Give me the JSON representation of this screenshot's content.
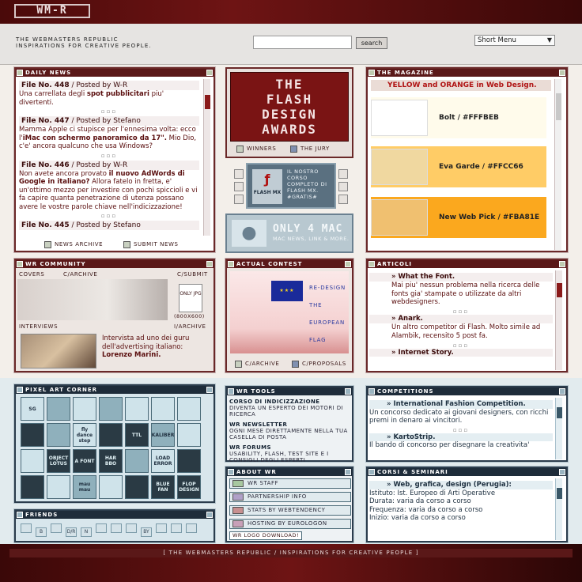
{
  "header": {
    "logo": "WM-R",
    "tagline_1": "THE WEBMASTERS REPUBLIC",
    "tagline_2": "INSPIRATIONS FOR CREATIVE PEOPLE.",
    "search_placeholder": "",
    "search_button": "search",
    "short_menu": "Short Menu"
  },
  "daily_news": {
    "title": "DAILY NEWS",
    "items": [
      {
        "num": "File No. 448",
        "by": " / Posted by W-R",
        "body_pre": "Una carrellata degli ",
        "body_bold": "spot pubblicitari",
        "body_post": " piu' divertenti."
      },
      {
        "num": "File No. 447",
        "by": " / Posted by Stefano",
        "body_pre": "Mamma Apple ci stupisce per l'ennesima volta: ecco l'",
        "body_bold": "iMac con schermo panoramico da 17\".",
        "body_post": " Mio Dio, c'e' ancora qualcuno che usa Windows?"
      },
      {
        "num": "File No. 446",
        "by": " / Posted by W-R",
        "body_pre": "Non avete ancora provato ",
        "body_bold": "il nuovo AdWords di Google in italiano?",
        "body_post": " Allora fatelo in fretta, e' un'ottimo mezzo per investire con pochi spiccioli e vi fa capire quanta penetrazione di utenza possano avere le vostre parole chiave nell'indicizzazione!"
      },
      {
        "num": "File No. 445",
        "by": " / Posted by Stefano"
      }
    ],
    "news_archive": "NEWS ARCHIVE",
    "submit_news": "SUBMIT NEWS"
  },
  "flash_awards": {
    "line1": "THE",
    "line2": "FLASH",
    "line3": "DESIGN",
    "line4": "AWARDS",
    "winners": "WINNERS",
    "jury": "THE JURY"
  },
  "flash_course": {
    "badge": "FLASH MX",
    "text": "IL NOSTRO CORSO COMPLETO DI FLASH MX. #GRATIS#"
  },
  "only4mac": {
    "title": "ONLY 4 MAC",
    "sub": "MAC NEWS, LINK & MORE."
  },
  "magazine": {
    "title": "THE MAGAZINE",
    "headline": "YELLOW and ORANGE in Web Design.",
    "rows": [
      {
        "label": "Bolt / #FFFBEB",
        "color": "#FFFBEB"
      },
      {
        "label": "Eva Garde / #FFCC66",
        "color": "#FFCC66"
      },
      {
        "label": "New Web Pick / #FBA81E",
        "color": "#FBA81E"
      }
    ]
  },
  "community": {
    "title": "WR COMMUNITY",
    "covers": "COVERS",
    "c_archive": "C/ARCHIVE",
    "c_submit": "C/SUBMIT",
    "only_jpg": "ONLY JPG",
    "size": "(800X600)",
    "interviews": "INTERVIEWS",
    "i_archive": "I/ARCHIVE",
    "interview_text": "Intervista ad uno dei guru dell'advertising italiano:",
    "interview_name": "Lorenzo Marini."
  },
  "contest": {
    "title": "ACTUAL CONTEST",
    "lines": [
      "RE-DESIGN",
      "THE",
      "EUROPEAN",
      "FLAG"
    ],
    "c_archive": "C/ARCHIVE",
    "c_proposals": "C/PROPOSALS"
  },
  "articoli": {
    "title": "ARTICOLI",
    "items": [
      {
        "title": "What the Font.",
        "body": "Mai piu' nessun problema nella ricerca delle fonts gia' stampate o utilizzate da altri webdesigners."
      },
      {
        "title": "Anark.",
        "body": "Un altro competitor di Flash. Molto simile ad Alambik, recensito 5 post fa."
      },
      {
        "title": "Internet Story.",
        "body": ""
      }
    ]
  },
  "pixel_art": {
    "title": "PIXEL ART CORNER",
    "tiles": [
      "SG",
      "",
      "",
      "",
      "",
      "",
      "",
      "",
      "",
      "fly dance step",
      "",
      "TTL",
      "KALIBER",
      "",
      "",
      "OBJECT LOTUS",
      "A FONT",
      "HAR BBO",
      "",
      "LOAD ERROR",
      "",
      "",
      "",
      "mau mau",
      "",
      "",
      "BLUE FAN",
      "FLOP DESIGN"
    ]
  },
  "tools": {
    "title": "WR TOOLS",
    "items": [
      {
        "name": "CORSO DI INDICIZZAZIONE",
        "desc": "DIVENTA UN ESPERTO DEI MOTORI DI RICERCA"
      },
      {
        "name": "WR NEWSLETTER",
        "desc": "OGNI MESE DIRETTAMENTE NELLA TUA CASELLA DI POSTA"
      },
      {
        "name": "WR FORUMS",
        "desc": "USABILITY, FLASH, TEST SITE E I CONSIGLI DEGLI ESPERTI"
      }
    ]
  },
  "about": {
    "title": "ABOUT WR",
    "items": [
      "WR STAFF",
      "PARTNERSHIP INFO",
      "STATS BY WEBTENDENCY",
      "HOSTING BY EUROLOGON"
    ],
    "logo_download": "WR LOGO DOWNLOAD!"
  },
  "competitions": {
    "title": "COMPETITIONS",
    "items": [
      {
        "title": "International Fashion Competition.",
        "body": "Un concorso dedicato ai giovani designers, con ricchi premi in denaro ai vincitori."
      },
      {
        "title": "KartoStrip.",
        "body": "Il bando di concorso per disegnare la creativita'"
      }
    ]
  },
  "corsi": {
    "title": "CORSI & SEMINARI",
    "item_title": "Web, grafica, design (Perugia):",
    "lines": [
      "Istituto: Ist. Europeo di Arti Operative",
      "Durata: varia da corso a corso",
      "Frequenza: varia da corso a corso",
      "Inizio: varia da corso a corso"
    ]
  },
  "friends": {
    "title": "FRIENDS",
    "icons": [
      "",
      "B",
      "",
      "D/R",
      "N",
      "",
      "",
      "",
      "BY",
      "",
      "",
      ""
    ]
  },
  "footer": {
    "text": "[ THE WEBMASTERS REPUBLIC / INSPIRATIONS FOR CREATIVE PEOPLE ]"
  }
}
